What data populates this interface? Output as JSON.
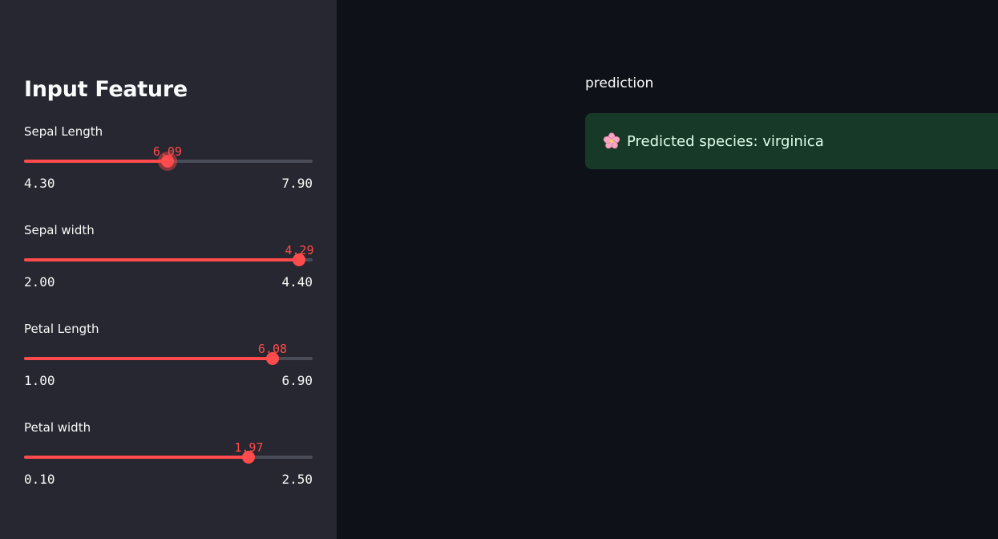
{
  "sidebar": {
    "title": "Input Feature",
    "sliders": [
      {
        "label": "Sepal Length",
        "value": "6.09",
        "min": "4.30",
        "max": "7.90",
        "fraction": 0.497
      },
      {
        "label": "Sepal width",
        "value": "4.29",
        "min": "2.00",
        "max": "4.40",
        "fraction": 0.954
      },
      {
        "label": "Petal Length",
        "value": "6.08",
        "min": "1.00",
        "max": "6.90",
        "fraction": 0.861
      },
      {
        "label": "Petal width",
        "value": "1.97",
        "min": "0.10",
        "max": "2.50",
        "fraction": 0.779
      }
    ]
  },
  "main": {
    "heading": "prediction",
    "alert": {
      "icon": "cherry-blossom-icon",
      "text": "Predicted species: virginica"
    }
  },
  "colors": {
    "accent": "#ff4b4b",
    "sidebar_bg": "#262730",
    "main_bg": "#0e1117",
    "success_bg": "#173928",
    "success_text": "#dffde9"
  }
}
